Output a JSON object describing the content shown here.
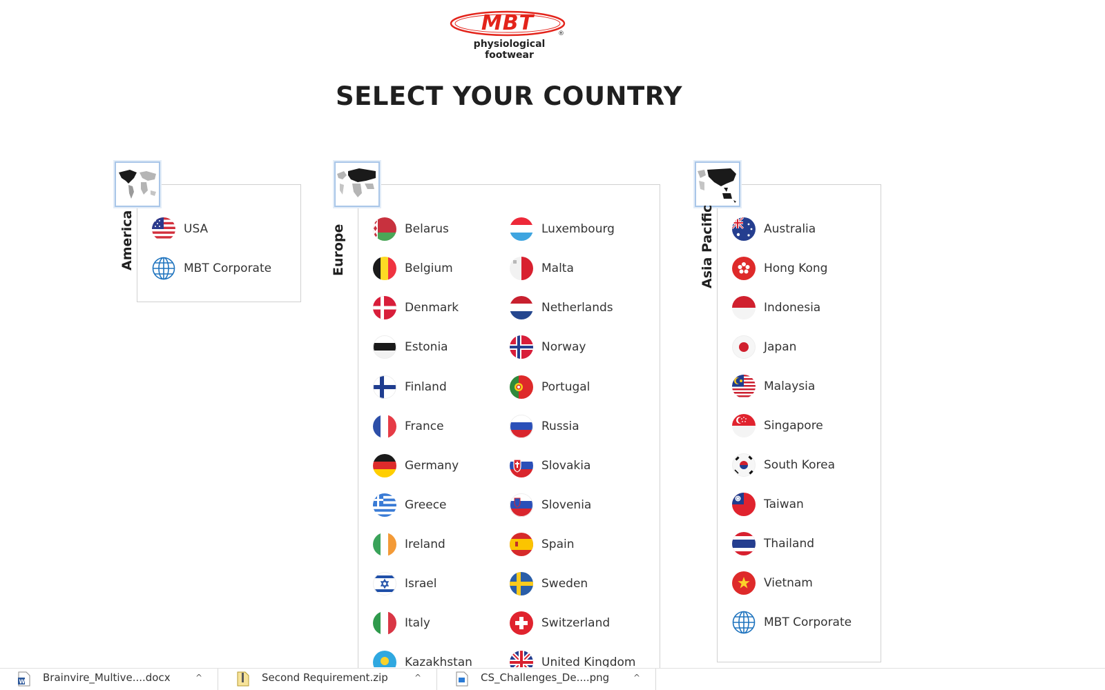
{
  "logo": {
    "brand": "MBT",
    "registered": "®",
    "tagline": "physiological footwear",
    "color": "#e3241b"
  },
  "page_title": "SELECT YOUR COUNTRY",
  "regions": {
    "america": {
      "label": "America",
      "map_icon": "world-map-america-icon",
      "countries": [
        {
          "name": "USA",
          "flag": "usa-flag-icon"
        },
        {
          "name": "MBT Corporate",
          "flag": "globe-icon"
        }
      ]
    },
    "europe": {
      "label": "Europe",
      "map_icon": "world-map-europe-icon",
      "countries": [
        {
          "name": "Belarus",
          "flag": "belarus-flag-icon"
        },
        {
          "name": "Belgium",
          "flag": "belgium-flag-icon"
        },
        {
          "name": "Denmark",
          "flag": "denmark-flag-icon"
        },
        {
          "name": "Estonia",
          "flag": "estonia-flag-icon"
        },
        {
          "name": "Finland",
          "flag": "finland-flag-icon"
        },
        {
          "name": "France",
          "flag": "france-flag-icon"
        },
        {
          "name": "Germany",
          "flag": "germany-flag-icon"
        },
        {
          "name": "Greece",
          "flag": "greece-flag-icon"
        },
        {
          "name": "Ireland",
          "flag": "ireland-flag-icon"
        },
        {
          "name": "Israel",
          "flag": "israel-flag-icon"
        },
        {
          "name": "Italy",
          "flag": "italy-flag-icon"
        },
        {
          "name": "Kazakhstan",
          "flag": "kazakhstan-flag-icon"
        },
        {
          "name": "Luxembourg",
          "flag": "luxembourg-flag-icon"
        },
        {
          "name": "Malta",
          "flag": "malta-flag-icon"
        },
        {
          "name": "Netherlands",
          "flag": "netherlands-flag-icon"
        },
        {
          "name": "Norway",
          "flag": "norway-flag-icon"
        },
        {
          "name": "Portugal",
          "flag": "portugal-flag-icon"
        },
        {
          "name": "Russia",
          "flag": "russia-flag-icon"
        },
        {
          "name": "Slovakia",
          "flag": "slovakia-flag-icon"
        },
        {
          "name": "Slovenia",
          "flag": "slovenia-flag-icon"
        },
        {
          "name": "Spain",
          "flag": "spain-flag-icon"
        },
        {
          "name": "Sweden",
          "flag": "sweden-flag-icon"
        },
        {
          "name": "Switzerland",
          "flag": "switzerland-flag-icon"
        },
        {
          "name": "United Kingdom",
          "flag": "uk-flag-icon"
        }
      ]
    },
    "asia_pacific": {
      "label": "Asia Pacific",
      "map_icon": "world-map-asia-icon",
      "countries": [
        {
          "name": "Australia",
          "flag": "australia-flag-icon"
        },
        {
          "name": "Hong Kong",
          "flag": "hong-kong-flag-icon"
        },
        {
          "name": "Indonesia",
          "flag": "indonesia-flag-icon"
        },
        {
          "name": "Japan",
          "flag": "japan-flag-icon"
        },
        {
          "name": "Malaysia",
          "flag": "malaysia-flag-icon"
        },
        {
          "name": "Singapore",
          "flag": "singapore-flag-icon"
        },
        {
          "name": "South Korea",
          "flag": "south-korea-flag-icon"
        },
        {
          "name": "Taiwan",
          "flag": "taiwan-flag-icon"
        },
        {
          "name": "Thailand",
          "flag": "thailand-flag-icon"
        },
        {
          "name": "Vietnam",
          "flag": "vietnam-flag-icon"
        },
        {
          "name": "MBT Corporate",
          "flag": "globe-icon"
        }
      ]
    }
  },
  "downloads": [
    {
      "name": "Brainvire_Multive....docx",
      "icon": "word-document-icon"
    },
    {
      "name": "Second Requirement.zip",
      "icon": "zip-archive-icon"
    },
    {
      "name": "CS_Challenges_De....png",
      "icon": "image-file-icon"
    }
  ],
  "download_caret": "^"
}
